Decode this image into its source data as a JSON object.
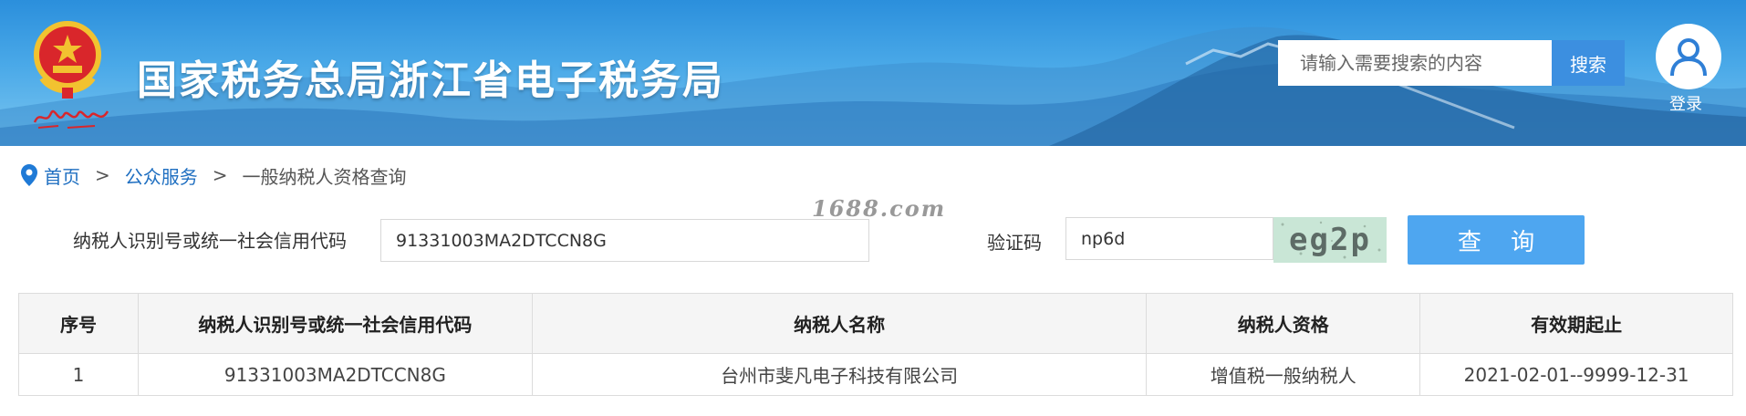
{
  "header": {
    "title": "国家税务总局浙江省电子税务局",
    "search_placeholder": "请输入需要搜索的内容",
    "search_button": "搜索",
    "login_label": "登录"
  },
  "breadcrumb": {
    "home": "首页",
    "sep1": ">",
    "section": "公众服务",
    "sep2": ">",
    "current": "一般纳税人资格查询"
  },
  "watermark": "1688.com",
  "form": {
    "taxpayer_id_label": "纳税人识别号或统一社会信用代码",
    "taxpayer_id_value": "91331003MA2DTCCN8G",
    "captcha_label": "验证码",
    "captcha_value": "np6d",
    "captcha_image_text": "eg2p",
    "query_button": "查 询"
  },
  "table": {
    "columns": [
      "序号",
      "纳税人识别号或统一社会信用代码",
      "纳税人名称",
      "纳税人资格",
      "有效期起止"
    ],
    "rows": [
      [
        "1",
        "91331003MA2DTCCN8G",
        "台州市斐凡电子科技有限公司",
        "增值税一般纳税人",
        "2021-02-01--9999-12-31"
      ]
    ]
  },
  "colors": {
    "banner": "#2b8fdc",
    "search_button": "#3c8fe0",
    "query_button": "#4ea6f0",
    "link": "#1f6fc1"
  },
  "icons": {
    "emblem": "national-emblem-icon",
    "location": "location-pin-icon",
    "user": "user-icon"
  }
}
